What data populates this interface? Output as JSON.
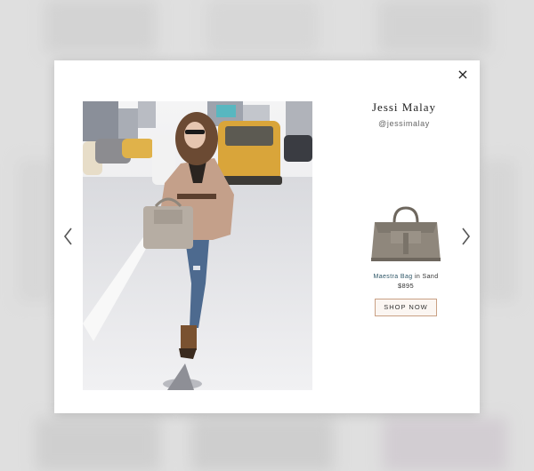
{
  "modal": {
    "close_label": "×",
    "prev_icon": "chevron-left-icon",
    "next_icon": "chevron-right-icon"
  },
  "author": {
    "name": "Jessi Malay",
    "handle": "@jessimalay"
  },
  "product": {
    "name": "Maestra Bag",
    "color_prefix": "in",
    "color": "Sand",
    "price": "$895",
    "cta": "SHOP NOW"
  },
  "colors": {
    "accent_link": "#2d5566",
    "button_border": "#c9a084",
    "bag": "#8f877c"
  }
}
